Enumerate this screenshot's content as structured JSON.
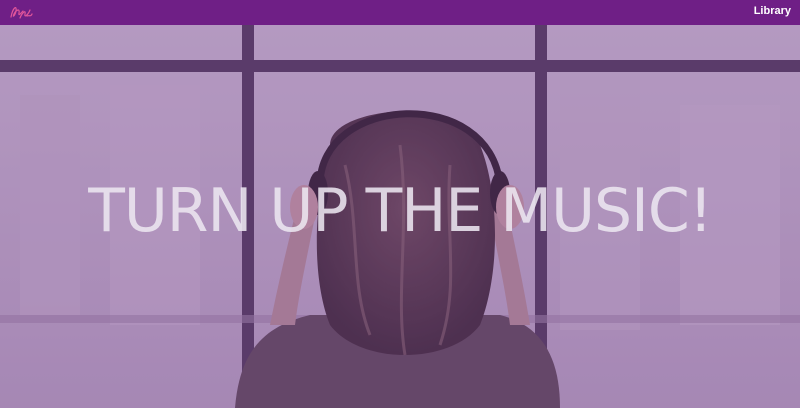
{
  "nav": {
    "logo_icon": "signature-logo-icon",
    "links": [
      {
        "label": "Library"
      }
    ]
  },
  "hero": {
    "title": "TURN UP THE MUSIC!",
    "background_icon": "woman-with-headphones-photo",
    "overlay_color": "#7b3f8f"
  },
  "colors": {
    "navbar": "#6f1f86",
    "accent_pink": "#e0559a",
    "title_text": "#ece6f0"
  }
}
